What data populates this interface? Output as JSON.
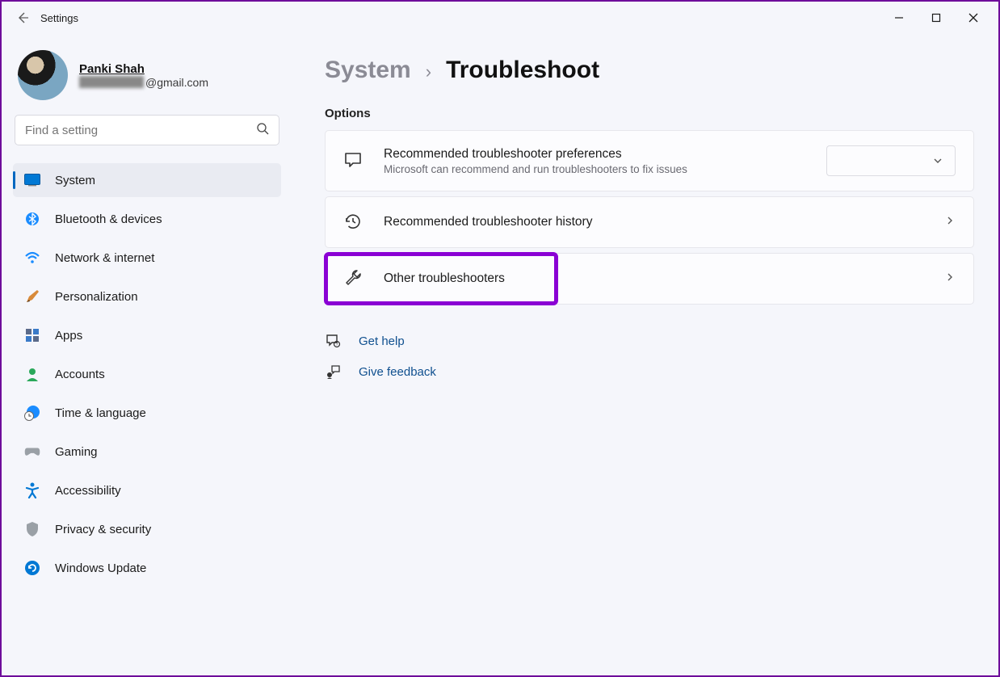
{
  "window": {
    "title": "Settings"
  },
  "profile": {
    "name": "Panki Shah",
    "email_suffix": "@gmail.com"
  },
  "search": {
    "placeholder": "Find a setting"
  },
  "sidebar": {
    "items": [
      {
        "label": "System"
      },
      {
        "label": "Bluetooth & devices"
      },
      {
        "label": "Network & internet"
      },
      {
        "label": "Personalization"
      },
      {
        "label": "Apps"
      },
      {
        "label": "Accounts"
      },
      {
        "label": "Time & language"
      },
      {
        "label": "Gaming"
      },
      {
        "label": "Accessibility"
      },
      {
        "label": "Privacy & security"
      },
      {
        "label": "Windows Update"
      }
    ]
  },
  "breadcrumb": {
    "parent": "System",
    "current": "Troubleshoot"
  },
  "section": {
    "label": "Options"
  },
  "cards": {
    "prefs": {
      "title": "Recommended troubleshooter preferences",
      "subtitle": "Microsoft can recommend and run troubleshooters to fix issues"
    },
    "history": {
      "title": "Recommended troubleshooter history"
    },
    "other": {
      "title": "Other troubleshooters"
    }
  },
  "footer": {
    "help": "Get help",
    "feedback": "Give feedback"
  }
}
